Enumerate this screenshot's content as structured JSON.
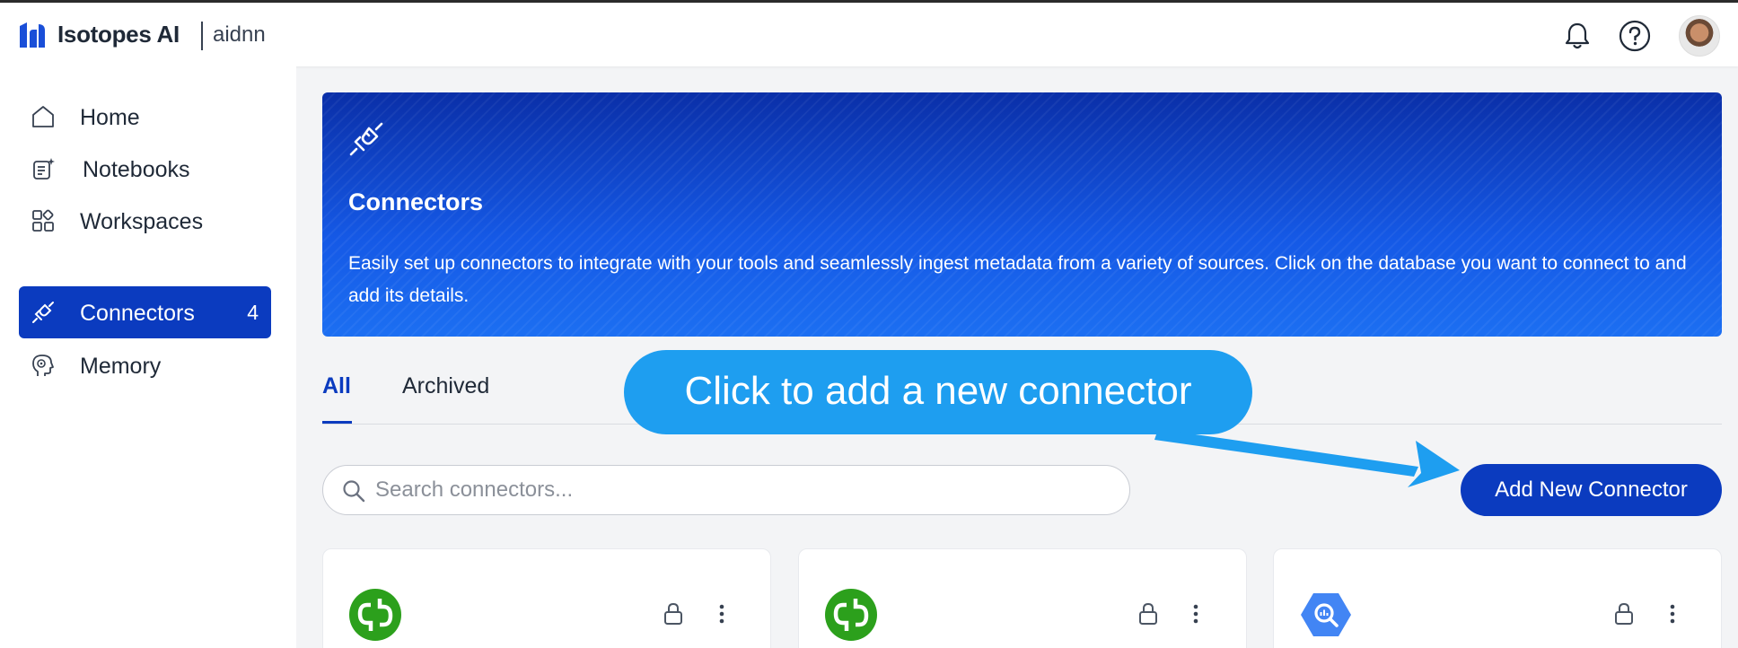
{
  "app": {
    "brand": "Isotopes AI",
    "sub_brand": "aidnn"
  },
  "sidebar": {
    "items": [
      {
        "label": "Home",
        "icon": "home-icon"
      },
      {
        "label": "Notebooks",
        "icon": "notebook-icon"
      },
      {
        "label": "Workspaces",
        "icon": "grid-icon"
      },
      {
        "label": "Connectors",
        "icon": "plug-icon",
        "count": "4",
        "active": true
      },
      {
        "label": "Memory",
        "icon": "brain-head-icon"
      }
    ]
  },
  "banner": {
    "title": "Connectors",
    "description": "Easily set up connectors to integrate with your tools and seamlessly ingest metadata from a variety of sources. Click on the database you want to connect to and add its details."
  },
  "tabs": {
    "all": "All",
    "archived": "Archived"
  },
  "search": {
    "placeholder": "Search connectors..."
  },
  "actions": {
    "add_new": "Add New Connector"
  },
  "callout": {
    "text": "Click to add a new connector"
  },
  "cards": [
    {
      "logo": "quickbooks-logo"
    },
    {
      "logo": "quickbooks-logo"
    },
    {
      "logo": "bigquery-logo"
    }
  ],
  "colors": {
    "primary": "#0b3bbf",
    "callout": "#1e9ef0",
    "quickbooks_green": "#2ca01c",
    "bigquery_blue": "#4285f4"
  }
}
